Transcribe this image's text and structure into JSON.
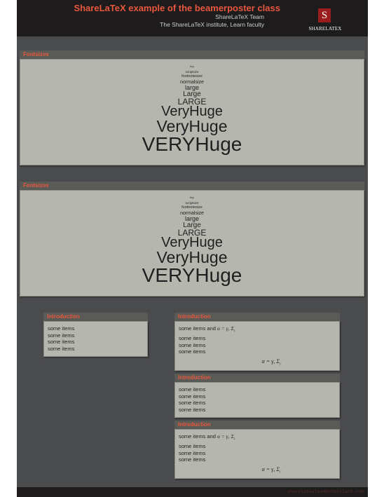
{
  "header": {
    "title": "ShareLaTeX example of the beamerposter class",
    "author": "ShareLaTeX Team",
    "institute": "The ShareLaTeX institute, Learn faculty",
    "logo_letter": "S",
    "logo_text": "SHARELATEX"
  },
  "fontsize_blocks": [
    {
      "title": "Fontsizes",
      "lines": [
        "tiny",
        "scriptsize",
        "footnotesize",
        "normalsize",
        "large",
        "Large",
        "LARGE",
        "VeryHuge",
        "VeryHuge",
        "VERYHuge"
      ]
    },
    {
      "title": "Fontsizes",
      "lines": [
        "tiny",
        "scriptsize",
        "footnotesize",
        "normalsize",
        "large",
        "Large",
        "LARGE",
        "VeryHuge",
        "VeryHuge",
        "VERYHuge"
      ]
    }
  ],
  "left_block": {
    "title": "Introduction",
    "items": [
      "some items",
      "some items",
      "some items",
      "some items"
    ]
  },
  "right_blocks": [
    {
      "title": "Introduction",
      "first_line": "some items and",
      "inline_math": "α = γ, Σ",
      "inline_sub": "i",
      "items": [
        "some items",
        "some items",
        "some items"
      ],
      "equation": "α = γ, Σ",
      "equation_sub": "i"
    },
    {
      "title": "Introduction",
      "items": [
        "some items",
        "some items",
        "some items",
        "some items"
      ]
    },
    {
      "title": "Introduction",
      "first_line": "some items and",
      "inline_math": "α = γ, Σ",
      "inline_sub": "i",
      "items": [
        "some items",
        "some items",
        "some items"
      ],
      "equation": "α = γ, Σ",
      "equation_sub": "i"
    }
  ],
  "footer": {
    "email": "sharelateateam@sharelate.com"
  },
  "colors": {
    "accent": "#e8573e",
    "background": "#4a4b4d",
    "block_body": "#b5b7af",
    "header_bar": "#1d1b1b"
  }
}
